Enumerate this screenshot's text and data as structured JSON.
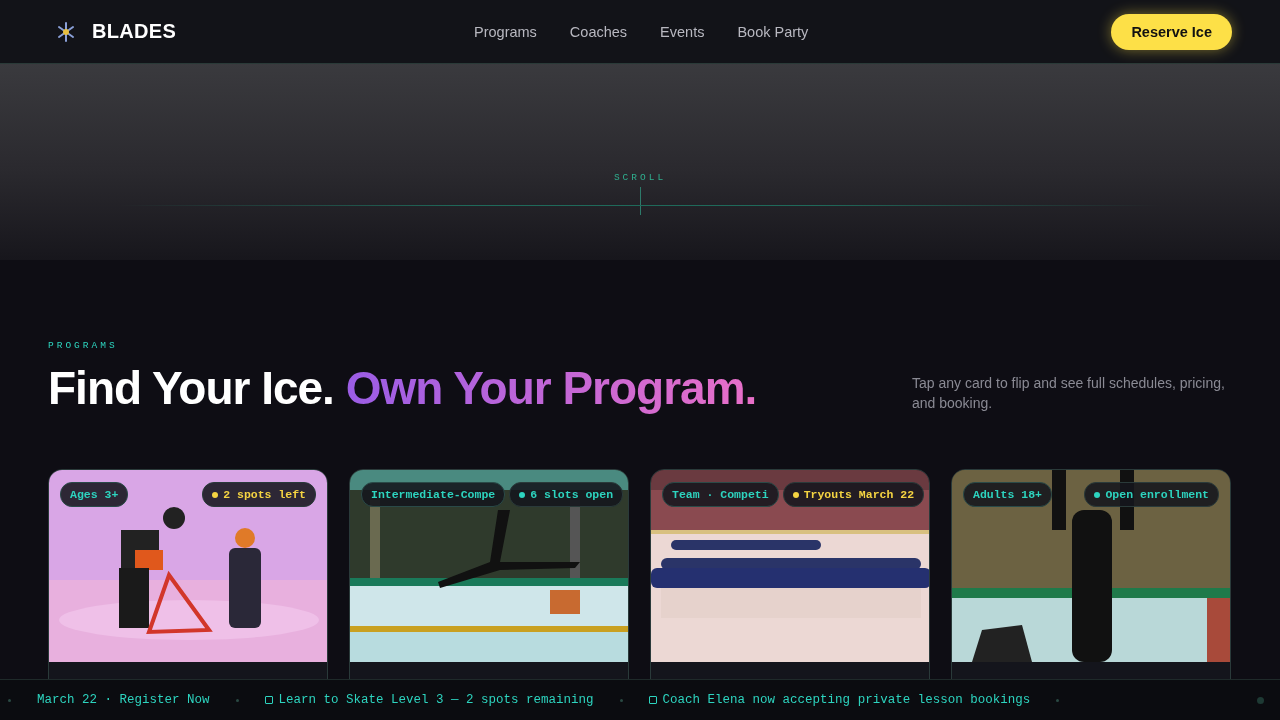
{
  "nav": {
    "brand": "BLADES",
    "links": [
      "Programs",
      "Coaches",
      "Events",
      "Book Party"
    ],
    "cta": "Reserve Ice"
  },
  "hero": {
    "scroll_label": "SCROLL"
  },
  "programs": {
    "eyebrow": "PROGRAMS",
    "heading_lead": "Find Your Ice.",
    "heading_accent": "Own Your Program.",
    "intro": "Tap any card to flip and see full schedules, pricing, and booking.",
    "cards": [
      {
        "tag": "Ages 3+",
        "status": "2 spots left",
        "color": "#f5d442"
      },
      {
        "tag": "Intermediate-Compe",
        "status": "6 slots open",
        "color": "#2dd4bf"
      },
      {
        "tag": "Team · Competi",
        "status": "Tryouts March 22",
        "color": "#f5d442"
      },
      {
        "tag": "Adults 18+",
        "status": "Open enrollment",
        "color": "#2dd4bf"
      }
    ]
  },
  "ticker": [
    "March 22 · Register Now",
    "Learn to Skate Level 3 — 2 spots remaining",
    "Coach Elena now accepting private lesson bookings"
  ]
}
